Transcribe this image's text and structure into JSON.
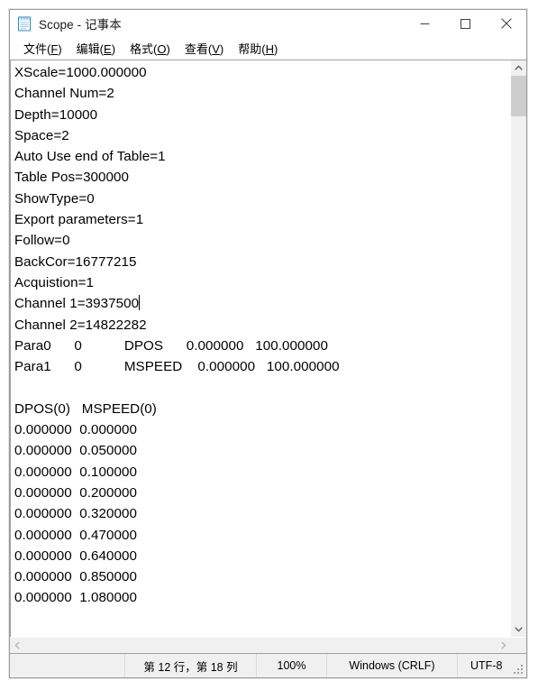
{
  "window": {
    "title": "Scope - 记事本",
    "icon": "notepad-icon",
    "controls": {
      "minimize": "minimize-icon",
      "maximize": "maximize-icon",
      "close": "close-icon"
    }
  },
  "menu": {
    "items": [
      {
        "label": "文件",
        "accel": "F"
      },
      {
        "label": "编辑",
        "accel": "E"
      },
      {
        "label": "格式",
        "accel": "O"
      },
      {
        "label": "查看",
        "accel": "V"
      },
      {
        "label": "帮助",
        "accel": "H"
      }
    ]
  },
  "editor": {
    "lines": [
      "XScale=1000.000000",
      "Channel Num=2",
      "Depth=10000",
      "Space=2",
      "Auto Use end of Table=1",
      "Table Pos=300000",
      "ShowType=0",
      "Export parameters=1",
      "Follow=0",
      "BackCor=16777215",
      "Acquistion=1",
      "Channel 1=3937500",
      "Channel 2=14822282",
      "Para0      0           DPOS      0.000000   100.000000",
      "Para1      0           MSPEED    0.000000   100.000000",
      "",
      "DPOS(0)   MSPEED(0)",
      "0.000000  0.000000",
      "0.000000  0.050000",
      "0.000000  0.100000",
      "0.000000  0.200000",
      "0.000000  0.320000",
      "0.000000  0.470000",
      "0.000000  0.640000",
      "0.000000  0.850000",
      "0.000000  1.080000"
    ],
    "caret_line_index": 11,
    "text_before_caret": "Channel 1=3937500",
    "text_after_caret": ""
  },
  "scrollbars": {
    "vertical_up": "chevron-up-icon",
    "vertical_down": "chevron-down-icon",
    "horizontal_left": "chevron-left-icon",
    "horizontal_right": "chevron-right-icon"
  },
  "status_bar": {
    "position": "第 12 行，第 18 列",
    "zoom": "100%",
    "line_ending": "Windows (CRLF)",
    "encoding": "UTF-8"
  },
  "colors": {
    "window_bg": "#ffffff",
    "chrome_bg": "#f0f0f0",
    "border": "#9a9a9a",
    "scroll_thumb": "#cdcdcd",
    "text": "#000000",
    "close_hover": "#e81123"
  }
}
